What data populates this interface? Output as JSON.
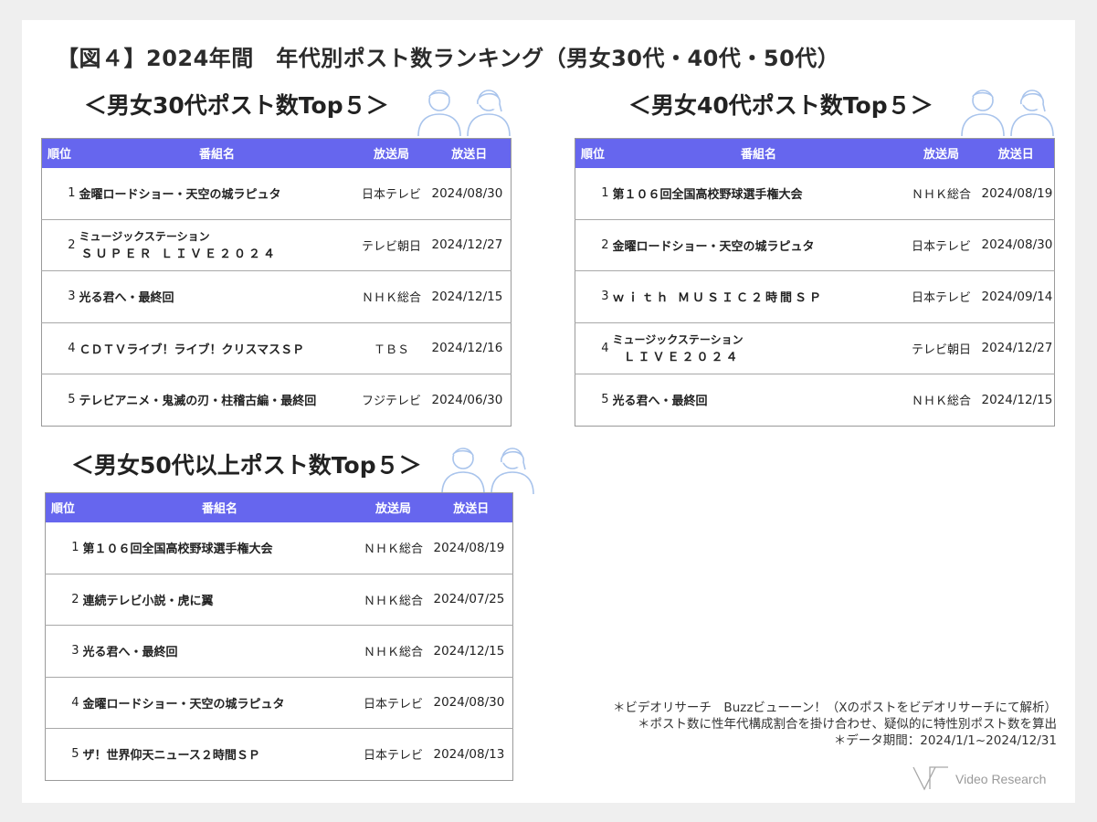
{
  "title": "【図４】2024年間　年代別ポスト数ランキング（男女30代・40代・50代）",
  "headers": {
    "rank": "順位",
    "program": "番組名",
    "station": "放送局",
    "date": "放送日"
  },
  "sections": [
    {
      "title": "＜男女30代ポスト数Top５＞",
      "rows": [
        {
          "rank": "1",
          "program": "金曜ロードショー・天空の城ラピュタ",
          "program_line2": "",
          "station": "日本テレビ",
          "date": "2024/08/30"
        },
        {
          "rank": "2",
          "program": "ミュージックステーション",
          "program_line2": "ＳＵＰＥＲ ＬＩＶＥ２０２４",
          "station": "テレビ朝日",
          "date": "2024/12/27"
        },
        {
          "rank": "3",
          "program": "光る君へ・最終回",
          "program_line2": "",
          "station": "ＮＨＫ総合",
          "date": "2024/12/15"
        },
        {
          "rank": "4",
          "program": "ＣＤＴＶライブ！ライブ！クリスマスＳＰ",
          "program_line2": "",
          "station": "ＴＢＳ",
          "date": "2024/12/16"
        },
        {
          "rank": "5",
          "program": "テレビアニメ・鬼滅の刃・柱稽古編・最終回",
          "program_line2": "",
          "station": "フジテレビ",
          "date": "2024/06/30"
        }
      ]
    },
    {
      "title": "＜男女40代ポスト数Top５＞",
      "rows": [
        {
          "rank": "1",
          "program": "第１０６回全国高校野球選手権大会",
          "program_line2": "",
          "station": "ＮＨＫ総合",
          "date": "2024/08/19"
        },
        {
          "rank": "2",
          "program": "金曜ロードショー・天空の城ラピュタ",
          "program_line2": "",
          "station": "日本テレビ",
          "date": "2024/08/30"
        },
        {
          "rank": "3",
          "program": "ｗｉｔｈ ＭＵＳＩＣ２時間ＳＰ",
          "program_line2": "",
          "station": "日本テレビ",
          "date": "2024/09/14"
        },
        {
          "rank": "4",
          "program": "ミュージックステーション",
          "program_line2": "ＬＩＶＥ２０２４",
          "station": "テレビ朝日",
          "date": "2024/12/27"
        },
        {
          "rank": "5",
          "program": "光る君へ・最終回",
          "program_line2": "",
          "station": "ＮＨＫ総合",
          "date": "2024/12/15"
        }
      ]
    },
    {
      "title": "＜男女50代以上ポスト数Top５＞",
      "rows": [
        {
          "rank": "1",
          "program": "第１０６回全国高校野球選手権大会",
          "program_line2": "",
          "station": "ＮＨＫ総合",
          "date": "2024/08/19"
        },
        {
          "rank": "2",
          "program": "連続テレビ小説・虎に翼",
          "program_line2": "",
          "station": "ＮＨＫ総合",
          "date": "2024/07/25"
        },
        {
          "rank": "3",
          "program": "光る君へ・最終回",
          "program_line2": "",
          "station": "ＮＨＫ総合",
          "date": "2024/12/15"
        },
        {
          "rank": "4",
          "program": "金曜ロードショー・天空の城ラピュタ",
          "program_line2": "",
          "station": "日本テレビ",
          "date": "2024/08/30"
        },
        {
          "rank": "5",
          "program": "ザ！世界仰天ニュース２時間ＳＰ",
          "program_line2": "",
          "station": "日本テレビ",
          "date": "2024/08/13"
        }
      ]
    }
  ],
  "notes": [
    "＊ビデオリサーチ　Buzzビューーン！（Xのポストをビデオリサーチにて解析）",
    "＊ポスト数に性年代構成割合を掛け合わせ、疑似的に特性別ポスト数を算出",
    "＊データ期間：2024/1/1~2024/12/31"
  ],
  "logo": {
    "text": "Video Research"
  },
  "colors": {
    "header_bg": "#6666ee",
    "icon_stroke": "#a9c4ec",
    "border": "#9a9a9a"
  },
  "icons": {
    "people": "people-icon",
    "logo_mark": "vr-logo-icon"
  }
}
